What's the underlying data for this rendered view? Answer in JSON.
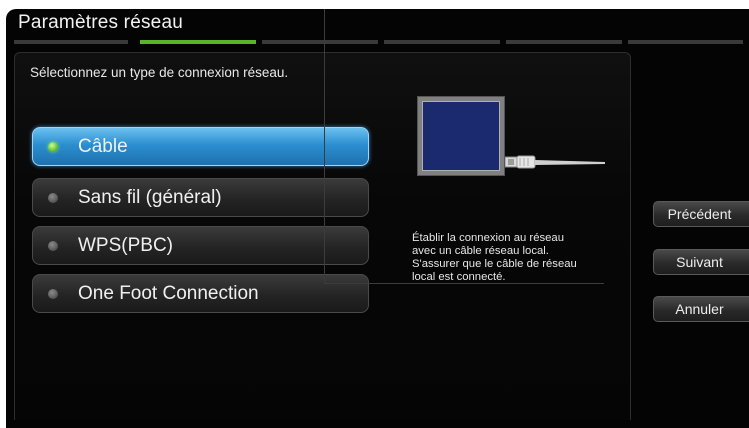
{
  "header": {
    "title": "Paramètres réseau"
  },
  "steps": {
    "count": 5,
    "active_index": 0
  },
  "main": {
    "instruction": "Sélectionnez un type de connexion réseau.",
    "options": [
      {
        "label": "Câble",
        "selected": true
      },
      {
        "label": "Sans fil (général)",
        "selected": false
      },
      {
        "label": "WPS(PBC)",
        "selected": false
      },
      {
        "label": "One Foot Connection",
        "selected": false
      }
    ],
    "description": "Établir la connexion au réseau\navec un câble réseau local.\nS'assurer que le câble de réseau\nlocal est connecté."
  },
  "buttons": {
    "previous": "Précédent",
    "next": "Suivant",
    "cancel": "Annuler"
  },
  "colors": {
    "accent_green": "#58b52a",
    "selected_blue": "#2b8fd0",
    "background": "#040404"
  },
  "icons": {
    "selected_indicator": "green-dot-icon",
    "unselected_indicator": "gray-dot-icon",
    "illustration": "tv-lan-cable-illustration"
  }
}
